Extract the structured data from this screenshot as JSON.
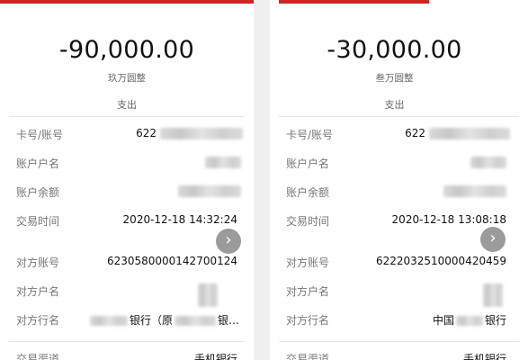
{
  "left": {
    "amount": "-90,000.00",
    "amount_words": "玖万圆整",
    "direction": "支出",
    "fields": [
      {
        "label": "卡号/账号",
        "value": "622"
      },
      {
        "label": "账户户名",
        "value": ""
      },
      {
        "label": "账户余额",
        "value": ""
      },
      {
        "label": "交易时间",
        "value": "2020-12-18 14:32:24"
      },
      {
        "label": "对方账号",
        "value": "6230580000142700124"
      },
      {
        "label": "对方户名",
        "value": ""
      },
      {
        "label": "对方行名",
        "value_prefix": "",
        "value": "银行（原",
        "value_suffix": "银…"
      },
      {
        "label": "交易渠道",
        "value": "手机银行"
      }
    ],
    "scroll_icon": "chevron-right-icon"
  },
  "right": {
    "amount": "-30,000.00",
    "amount_words": "叁万圆整",
    "direction": "支出",
    "fields": [
      {
        "label": "卡号/账号",
        "value": "622"
      },
      {
        "label": "账户户名",
        "value": ""
      },
      {
        "label": "账户余额",
        "value": ""
      },
      {
        "label": "交易时间",
        "value": "2020-12-18 13:08:18"
      },
      {
        "label": "对方账号",
        "value": "6222032510000420459"
      },
      {
        "label": "对方户名",
        "value": ""
      },
      {
        "label": "对方行名",
        "value": "中国",
        "value_suffix": "银行"
      },
      {
        "label": "交易渠道",
        "value": "手机银行"
      }
    ],
    "scroll_icon": "chevron-right-icon"
  },
  "colors": {
    "accent": "#d7231f",
    "scroll_button": "#9b9b9b"
  }
}
